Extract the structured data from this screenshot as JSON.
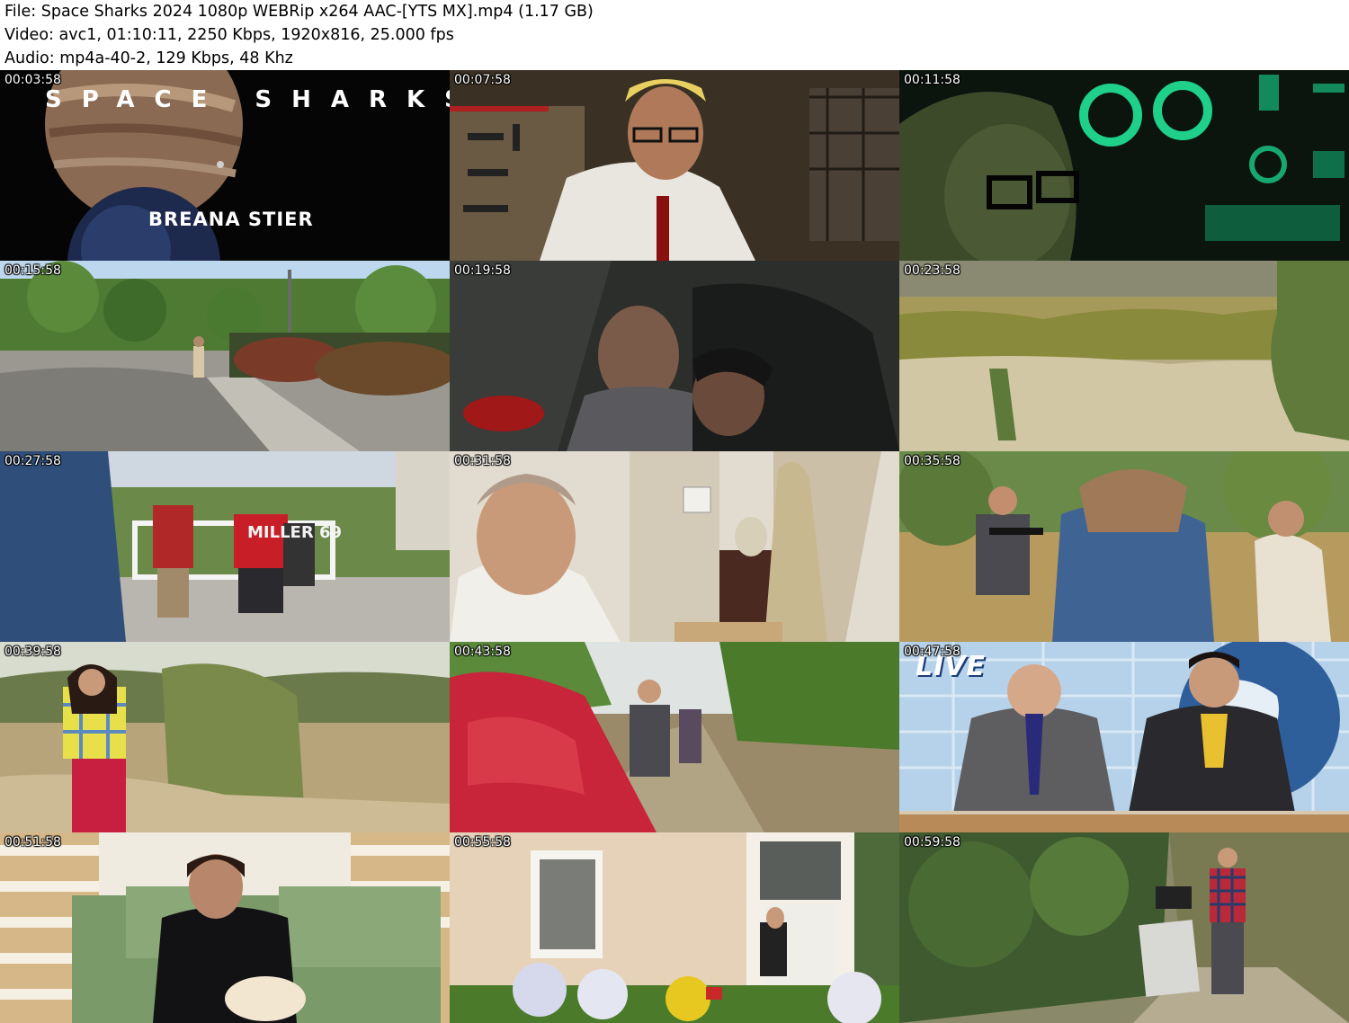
{
  "header": {
    "file_line": "File: Space Sharks 2024 1080p WEBRip x264 AAC-[YTS MX].mp4 (1.17 GB)",
    "video_line": "Video: avc1, 01:10:11, 2250 Kbps, 1920x816, 25.000 fps",
    "audio_line": "Audio: mp4a-40-2, 129 Kbps, 48 Khz"
  },
  "thumbnails": [
    {
      "timestamp": "00:03:58",
      "title_text": "SPACE SHARKS",
      "name_text": "BREANA STIER"
    },
    {
      "timestamp": "00:07:58"
    },
    {
      "timestamp": "00:11:58"
    },
    {
      "timestamp": "00:15:58"
    },
    {
      "timestamp": "00:19:58"
    },
    {
      "timestamp": "00:23:58"
    },
    {
      "timestamp": "00:27:58",
      "shirt_text": "MILLER 69"
    },
    {
      "timestamp": "00:31:58"
    },
    {
      "timestamp": "00:35:58"
    },
    {
      "timestamp": "00:39:58"
    },
    {
      "timestamp": "00:43:58"
    },
    {
      "timestamp": "00:47:58",
      "overlay_text": "LIVE"
    },
    {
      "timestamp": "00:51:58"
    },
    {
      "timestamp": "00:55:58"
    },
    {
      "timestamp": "00:59:58"
    }
  ]
}
